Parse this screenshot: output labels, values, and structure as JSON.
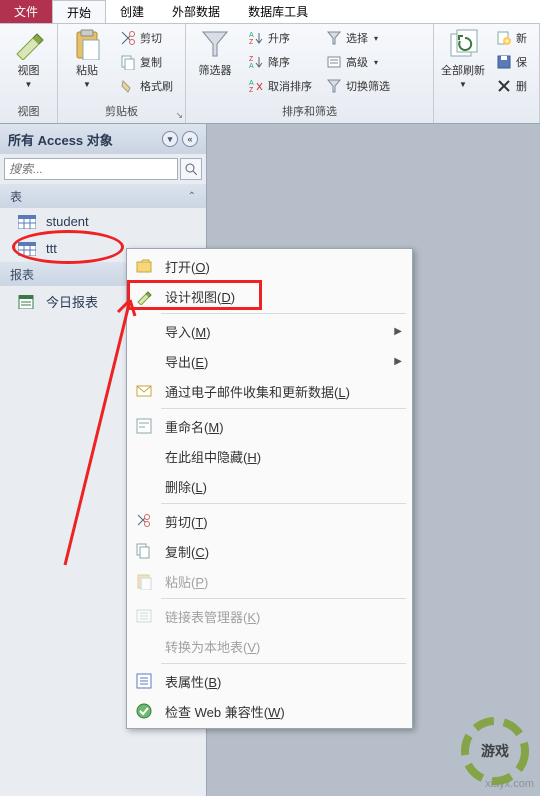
{
  "tabs": {
    "file": "文件",
    "home": "开始",
    "create": "创建",
    "external": "外部数据",
    "dbtools": "数据库工具"
  },
  "ribbon": {
    "view": {
      "label": "视图",
      "group": "视图"
    },
    "paste": "粘贴",
    "cut": "剪切",
    "copy": "复制",
    "format": "格式刷",
    "clipboard_group": "剪贴板",
    "filter": "筛选器",
    "asc": "升序",
    "desc": "降序",
    "clearsort": "取消排序",
    "selection": "选择",
    "advanced": "高级",
    "togglefilter": "切换筛选",
    "sortfilter_group": "排序和筛选",
    "refreshall": "全部刷新",
    "new": "新",
    "save": "保",
    "delete": "删"
  },
  "nav": {
    "title": "所有 Access 对象",
    "search_placeholder": "搜索...",
    "cat_tables": "表",
    "cat_reports": "报表",
    "items": {
      "student": "student",
      "ttt": "ttt",
      "today": "今日报表"
    }
  },
  "ctx": {
    "open": "打开(",
    "open_k": "O",
    "design": "设计视图(",
    "design_k": "D",
    "import": "导入(",
    "import_k": "M",
    "export": "导出(",
    "export_k": "E",
    "email": "通过电子邮件收集和更新数据(",
    "email_k": "L",
    "rename": "重命名(",
    "rename_k": "M",
    "hide": "在此组中隐藏(",
    "hide_k": "H",
    "delete": "删除(",
    "delete_k": "L",
    "cut": "剪切(",
    "cut_k": "T",
    "copy": "复制(",
    "copy_k": "C",
    "paste": "粘贴(",
    "paste_k": "P",
    "linkmgr": "链接表管理器(",
    "linkmgr_k": "K",
    "convert": "转换为本地表(",
    "convert_k": "V",
    "props": "表属性(",
    "props_k": "B",
    "webcheck": "检查 Web 兼容性(",
    "webcheck_k": "W",
    "close": ")"
  },
  "watermark": "xiayx.com"
}
